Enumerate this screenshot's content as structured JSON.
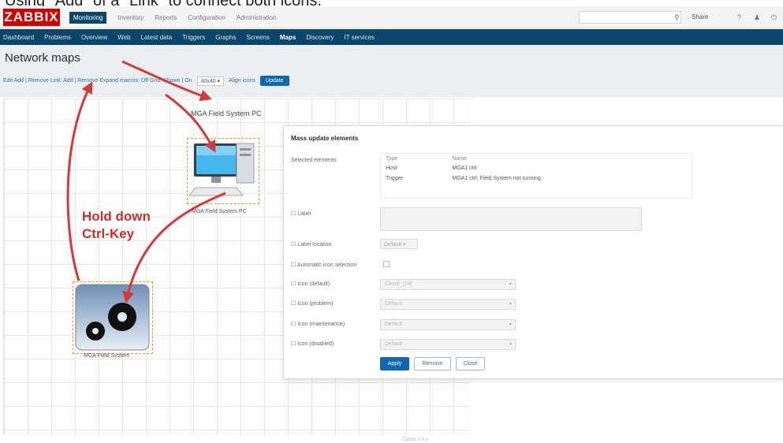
{
  "caption": "Using \"Add\" of a \"Link\" to connect both icons.",
  "logo": "ZABBIX",
  "top_menu": [
    "Monitoring",
    "Inventory",
    "Reports",
    "Configuration",
    "Administration"
  ],
  "top_right": {
    "share_label": "Share",
    "help": "?",
    "user": "♟",
    "signout": "⏻"
  },
  "sub_menu": [
    "Dashboard",
    "Problems",
    "Overview",
    "Web",
    "Latest data",
    "Triggers",
    "Graphs",
    "Screens",
    "Maps",
    "Discovery",
    "IT services"
  ],
  "page_title": "Network maps",
  "toolbar": {
    "links": "Edit  Add | Remove  Link: Add | Remove  Expand macros: Off  Grid: Shown | On",
    "grid_size": "40x40",
    "align_icons": "Align icons",
    "update": "Update"
  },
  "map": {
    "top_label": "MGA Field System PC",
    "pc_label": "MGA Field System PC",
    "system_label": "MGA Field System",
    "annotation_line1": "Hold down",
    "annotation_line2": "Ctrl-Key"
  },
  "dialog": {
    "title": "Mass update elements",
    "selected_label": "Selected elements",
    "columns": [
      "Type",
      "Name"
    ],
    "rows": [
      {
        "type": "Host",
        "name": "MGA1 ctrl"
      },
      {
        "type": "Trigger",
        "name": "MGA1 ctrl: Field System not running"
      }
    ],
    "label_field": "Label",
    "label_location": "Label location",
    "label_location_value": "Default",
    "auto_icon": "Automatic icon selection",
    "icon_default": "Icon (default)",
    "icon_default_value": "Cloud_(24)",
    "icon_problem": "Icon (problem)",
    "icon_problem_value": "Default",
    "icon_maintenance": "Icon (maintenance)",
    "icon_maintenance_value": "Default",
    "icon_disabled": "Icon (disabled)",
    "icon_disabled_value": "Default",
    "apply": "Apply",
    "remove": "Remove",
    "close": "Close"
  },
  "footer": "Zabbix 3.4.x"
}
